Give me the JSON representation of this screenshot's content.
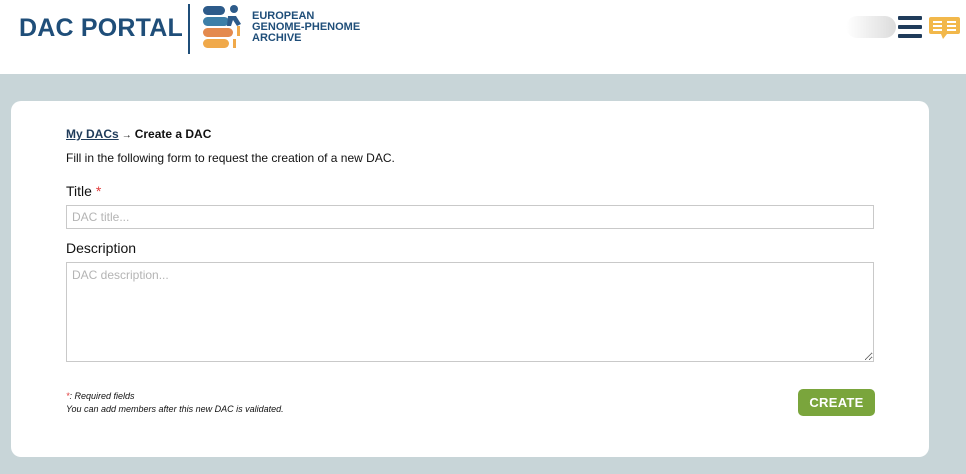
{
  "header": {
    "portal_title": "DAC PORTAL",
    "logo_lines": [
      "EUROPEAN",
      "GENOME-PHENOME",
      "ARCHIVE"
    ]
  },
  "breadcrumb": {
    "parent": "My DACs",
    "separator": "→",
    "current": "Create a DAC"
  },
  "intro": "Fill in the following form to request the creation of a new DAC.",
  "form": {
    "title_label": "Title",
    "required_marker": "*",
    "title_placeholder": "DAC title...",
    "title_value": "",
    "description_label": "Description",
    "description_placeholder": "DAC description...",
    "description_value": ""
  },
  "notes": {
    "required_marker": "*",
    "required_text": ": Required fields",
    "members_text": "You can add members after this new DAC is validated."
  },
  "actions": {
    "create_label": "CREATE"
  },
  "colors": {
    "brand": "#1f4e79",
    "page_background": "#c8d5d8",
    "create_button": "#7aa53c",
    "required": "#e03b3b"
  },
  "icons": [
    "ega-logo-icon",
    "menu-icon",
    "chat-icon"
  ]
}
